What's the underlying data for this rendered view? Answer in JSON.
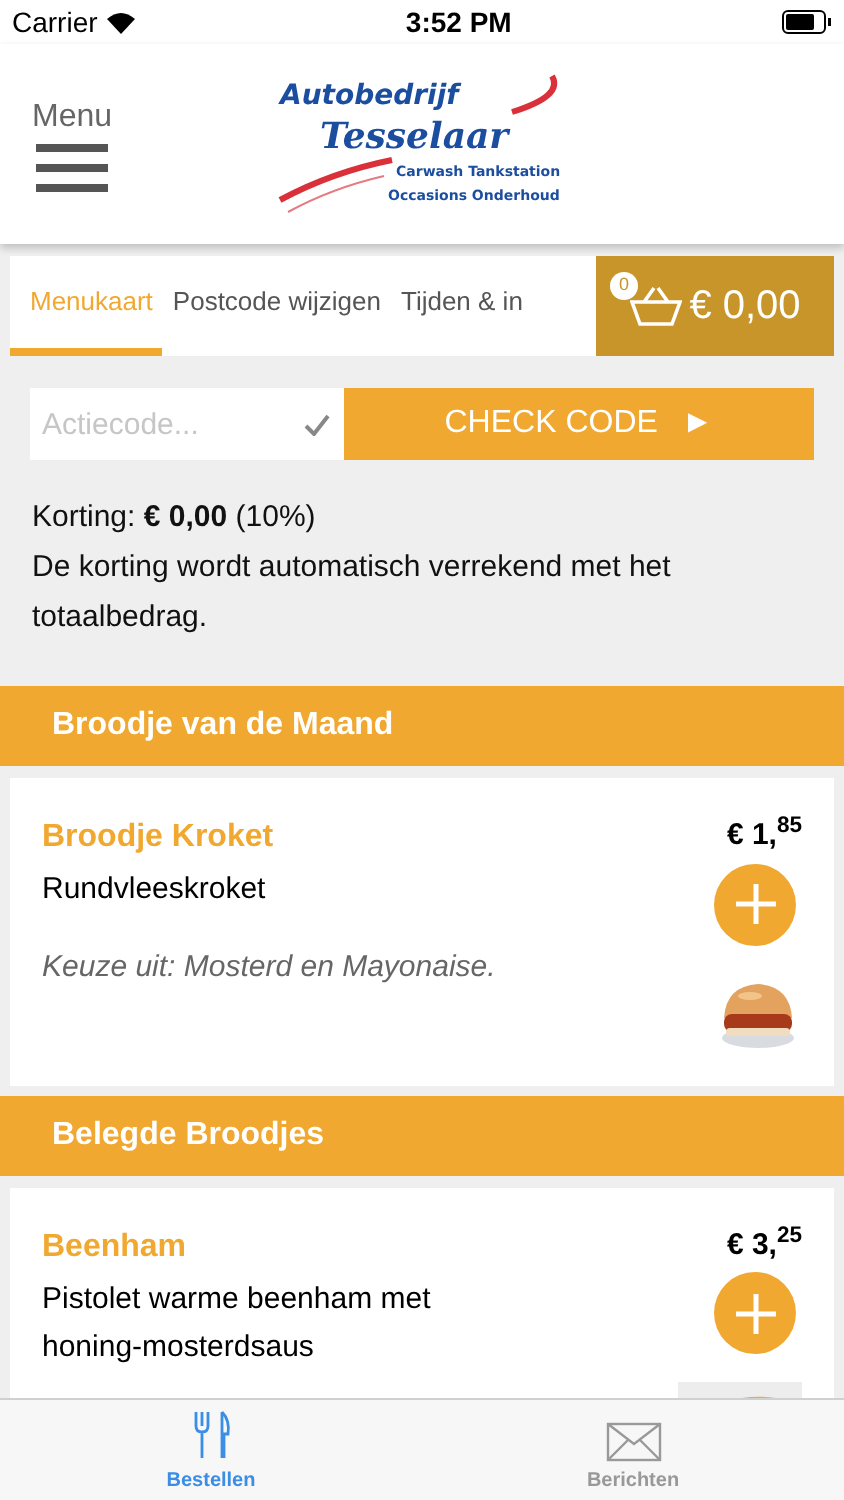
{
  "status_bar": {
    "carrier": "Carrier",
    "time": "3:52 PM"
  },
  "header": {
    "menu_label": "Menu",
    "logo": {
      "name": "Autobedrijf",
      "script": "Tesselaar",
      "tagline_1": "Carwash  Tankstation",
      "tagline_2": "Occasions  Onderhoud"
    }
  },
  "tabs": [
    {
      "label": "Menukaart",
      "selected": true
    },
    {
      "label": "Postcode wijzigen",
      "selected": false
    },
    {
      "label": "Tijden & in",
      "selected": false
    }
  ],
  "cart": {
    "count": "0",
    "total": "€ 0,00"
  },
  "promo": {
    "placeholder": "Actiecode...",
    "button": "CHECK CODE",
    "button_icon": "►"
  },
  "discount": {
    "line": "Korting: **€ 0,00** (10%)",
    "note": "De korting wordt automatisch verrekend met het totaalbedrag."
  },
  "sections": [
    {
      "title": "Broodje van de Maand",
      "items": [
        {
          "name": "Broodje Kroket",
          "description": "Rundvleeskroket",
          "note": "Keuze uit: Mosterd en Mayonaise.",
          "price": "€ 1,$^{85}$"
        }
      ]
    },
    {
      "title": "Belegde Broodjes",
      "items": [
        {
          "name": "Beenham",
          "description": "Pistolet warme beenham met honing-mosterdsaus",
          "price": "€ 3,$^{25}$"
        }
      ]
    }
  ],
  "bottom_tabs": [
    {
      "label": "Bestellen",
      "kind": "cutlery",
      "selected": true
    },
    {
      "label": "Berichten",
      "kind": "envelope",
      "selected": false
    }
  ]
}
